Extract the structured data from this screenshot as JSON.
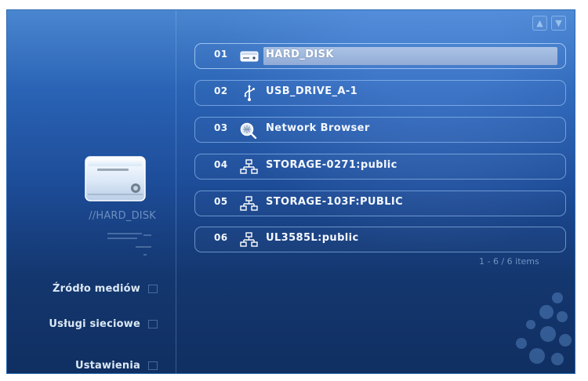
{
  "header": {
    "up_arrow": "▲",
    "down_arrow": "▼"
  },
  "sidebar": {
    "source_name": "//HARD_DISK",
    "menu": [
      {
        "label": "Źródło mediów"
      },
      {
        "label": "Usługi sieciowe"
      },
      {
        "label": "Ustawienia"
      }
    ]
  },
  "devices": [
    {
      "index": "01",
      "label": "HARD_DISK",
      "icon": "hard-disk-icon",
      "selected": true
    },
    {
      "index": "02",
      "label": "USB_DRIVE_A-1",
      "icon": "usb-icon",
      "selected": false
    },
    {
      "index": "03",
      "label": "Network Browser",
      "icon": "network-browser-icon",
      "selected": false
    },
    {
      "index": "04",
      "label": "STORAGE-0271:public",
      "icon": "network-share-icon",
      "selected": false
    },
    {
      "index": "05",
      "label": "STORAGE-103F:PUBLIC",
      "icon": "network-share-icon",
      "selected": false
    },
    {
      "index": "06",
      "label": "UL3585L:public",
      "icon": "network-share-icon",
      "selected": false
    }
  ],
  "status": {
    "count_text": "1 - 6 / 6 items"
  },
  "colors": {
    "background_top": "#4a86d0",
    "background_bottom": "#102f62",
    "item_border": "#9ecbff",
    "selection": "#b0c6e6",
    "text": "#f4f8ff"
  }
}
